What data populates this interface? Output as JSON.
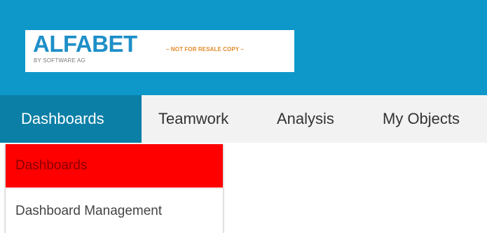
{
  "brand": {
    "name": "ALFABET",
    "byline": "BY SOFTWARE AG",
    "tagline": "– NOT FOR RESALE COPY –",
    "colors": {
      "header_bg": "#0e98c9",
      "logo_text": "#1d8fc8",
      "tagline_text": "#e38a2a"
    }
  },
  "menubar": {
    "items": [
      {
        "label": "Dashboards",
        "active": true
      },
      {
        "label": "Teamwork",
        "active": false
      },
      {
        "label": "Analysis",
        "active": false
      },
      {
        "label": "My Objects",
        "active": false
      }
    ],
    "colors": {
      "bar_bg": "#f2f2f2",
      "active_bg": "#0b7fa6"
    }
  },
  "dropdown": {
    "items": [
      {
        "label": "Dashboards",
        "highlighted": true
      },
      {
        "label": "Dashboard Management",
        "highlighted": false
      }
    ],
    "colors": {
      "highlight_bg": "#ff0000"
    }
  }
}
